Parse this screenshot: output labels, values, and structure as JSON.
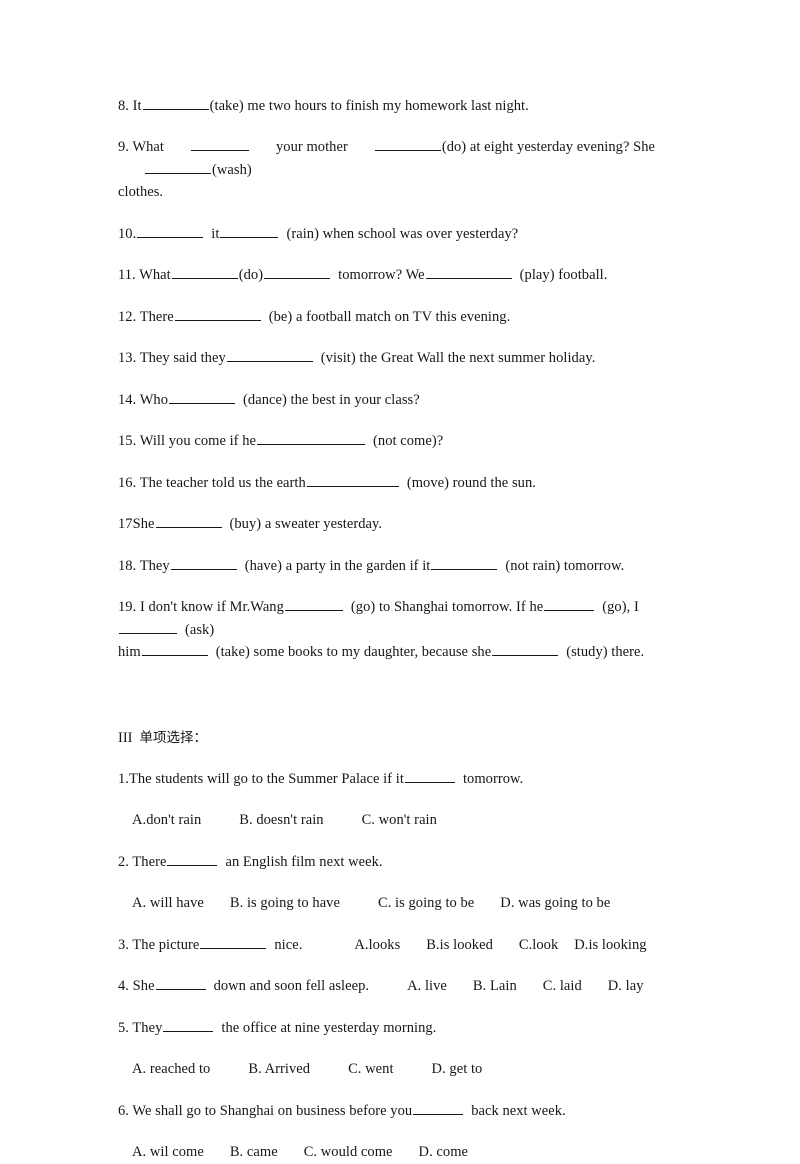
{
  "document": {
    "type": "english-grammar-worksheet",
    "language_note": "English exercises with a Chinese section heading"
  },
  "fill_in_blanks": {
    "items": [
      {
        "number": "8.",
        "parts": [
          "8. It",
          "(take) me two hours to finish my homework last night."
        ],
        "full_text": "8. It ________(take) me two hours to finish my homework last night."
      },
      {
        "number": "9.",
        "segments": [
          "9. What",
          "your mother",
          "(do) at eight yesterday evening? She",
          "(wash)"
        ],
        "continuation": "clothes.",
        "full_text": "9. What ______ your mother _______(do) at eight yesterday evening? She _______(wash) clothes."
      },
      {
        "number": "10.",
        "segments": [
          "10.",
          "it",
          "(rain) when school was over yesterday?"
        ],
        "full_text": "10. _______ it ______ (rain) when school was over yesterday?"
      },
      {
        "number": "11.",
        "segments": [
          "11. What",
          "(do)",
          "tomorrow? We",
          "(play) football."
        ],
        "full_text": "11. What _______(do) ________ tomorrow? We _________ (play) football."
      },
      {
        "number": "12.",
        "segments": [
          "12. There",
          "(be) a football match on TV this evening."
        ],
        "full_text": "12. There _________ (be) a football match on TV this evening."
      },
      {
        "number": "13.",
        "segments": [
          "13. They said they",
          "(visit) the Great Wall the next summer holiday."
        ],
        "full_text": "13. They said they _________ (visit) the Great Wall the next summer holiday."
      },
      {
        "number": "14.",
        "segments": [
          "14. Who",
          "(dance) the best in your class?"
        ],
        "full_text": "14. Who ________ (dance) the best in your class?"
      },
      {
        "number": "15.",
        "segments": [
          "15. Will you come if he",
          "(not come)?"
        ],
        "full_text": "15. Will you come if he _____________ (not come)?"
      },
      {
        "number": "16.",
        "segments": [
          "16. The teacher told us the earth",
          "(move) round the sun."
        ],
        "full_text": "16. The teacher told us the earth __________ (move) round the sun."
      },
      {
        "number": "17",
        "segments": [
          "17She",
          "(buy) a sweater yesterday."
        ],
        "full_text": "17She ________ (buy) a sweater yesterday."
      },
      {
        "number": "18.",
        "segments": [
          "18. They",
          "(have) a party in the garden if it",
          "(not rain) tomorrow."
        ],
        "full_text": "18. They _______ (have) a party in the garden if it ________ (not rain) tomorrow."
      },
      {
        "number": "19.",
        "segments": [
          "19. I don't know if Mr.Wang",
          "(go) to Shanghai tomorrow. If he",
          "(go), I",
          "(ask)"
        ],
        "continuation_segments": [
          "him",
          "(take) some books to my daughter, because she",
          "(study) there."
        ],
        "full_text": "19. I don't know if Mr.Wang ______ (go) to Shanghai tomorrow. If he _____ (go), I ______ (ask) him _______ (take) some books to my daughter, because she _______ (study) there."
      }
    ]
  },
  "multiple_choice": {
    "heading_numeral": "III",
    "heading_label": "单项选择：",
    "heading_full": "III 单项选择：",
    "questions": [
      {
        "stem_before": "1.The students will go to the Summer Palace if it",
        "stem_after": "tomorrow.",
        "options_on_same_line": false,
        "options": [
          "A.don't rain",
          "B. doesn't rain",
          "C. won't rain"
        ]
      },
      {
        "stem_before": "2. There",
        "stem_after": "an English film next week.",
        "options_on_same_line": false,
        "options": [
          "A. will have",
          "B. is going to have",
          "C. is going to be",
          "D. was going to be"
        ]
      },
      {
        "stem_before": "3. The picture",
        "stem_after": "nice.",
        "options_on_same_line": true,
        "options": [
          "A.looks",
          "B.is looked",
          "C.look",
          "D.is looking"
        ]
      },
      {
        "stem_before": "4. She",
        "stem_after": "down and soon fell asleep.",
        "options_on_same_line": true,
        "options": [
          "A. live",
          "B. Lain",
          "C. laid",
          "D. lay"
        ]
      },
      {
        "stem_before": "5. They",
        "stem_after": "the office at nine yesterday morning.",
        "options_on_same_line": false,
        "options": [
          "A. reached to",
          "B. Arrived",
          "C. went",
          "D. get to"
        ]
      },
      {
        "stem_before": "6. We shall go to Shanghai on business before you",
        "stem_after": "back next week.",
        "options_on_same_line": false,
        "options": [
          "A. wil come",
          "B. came",
          "C. would come",
          "D. come"
        ]
      }
    ]
  }
}
